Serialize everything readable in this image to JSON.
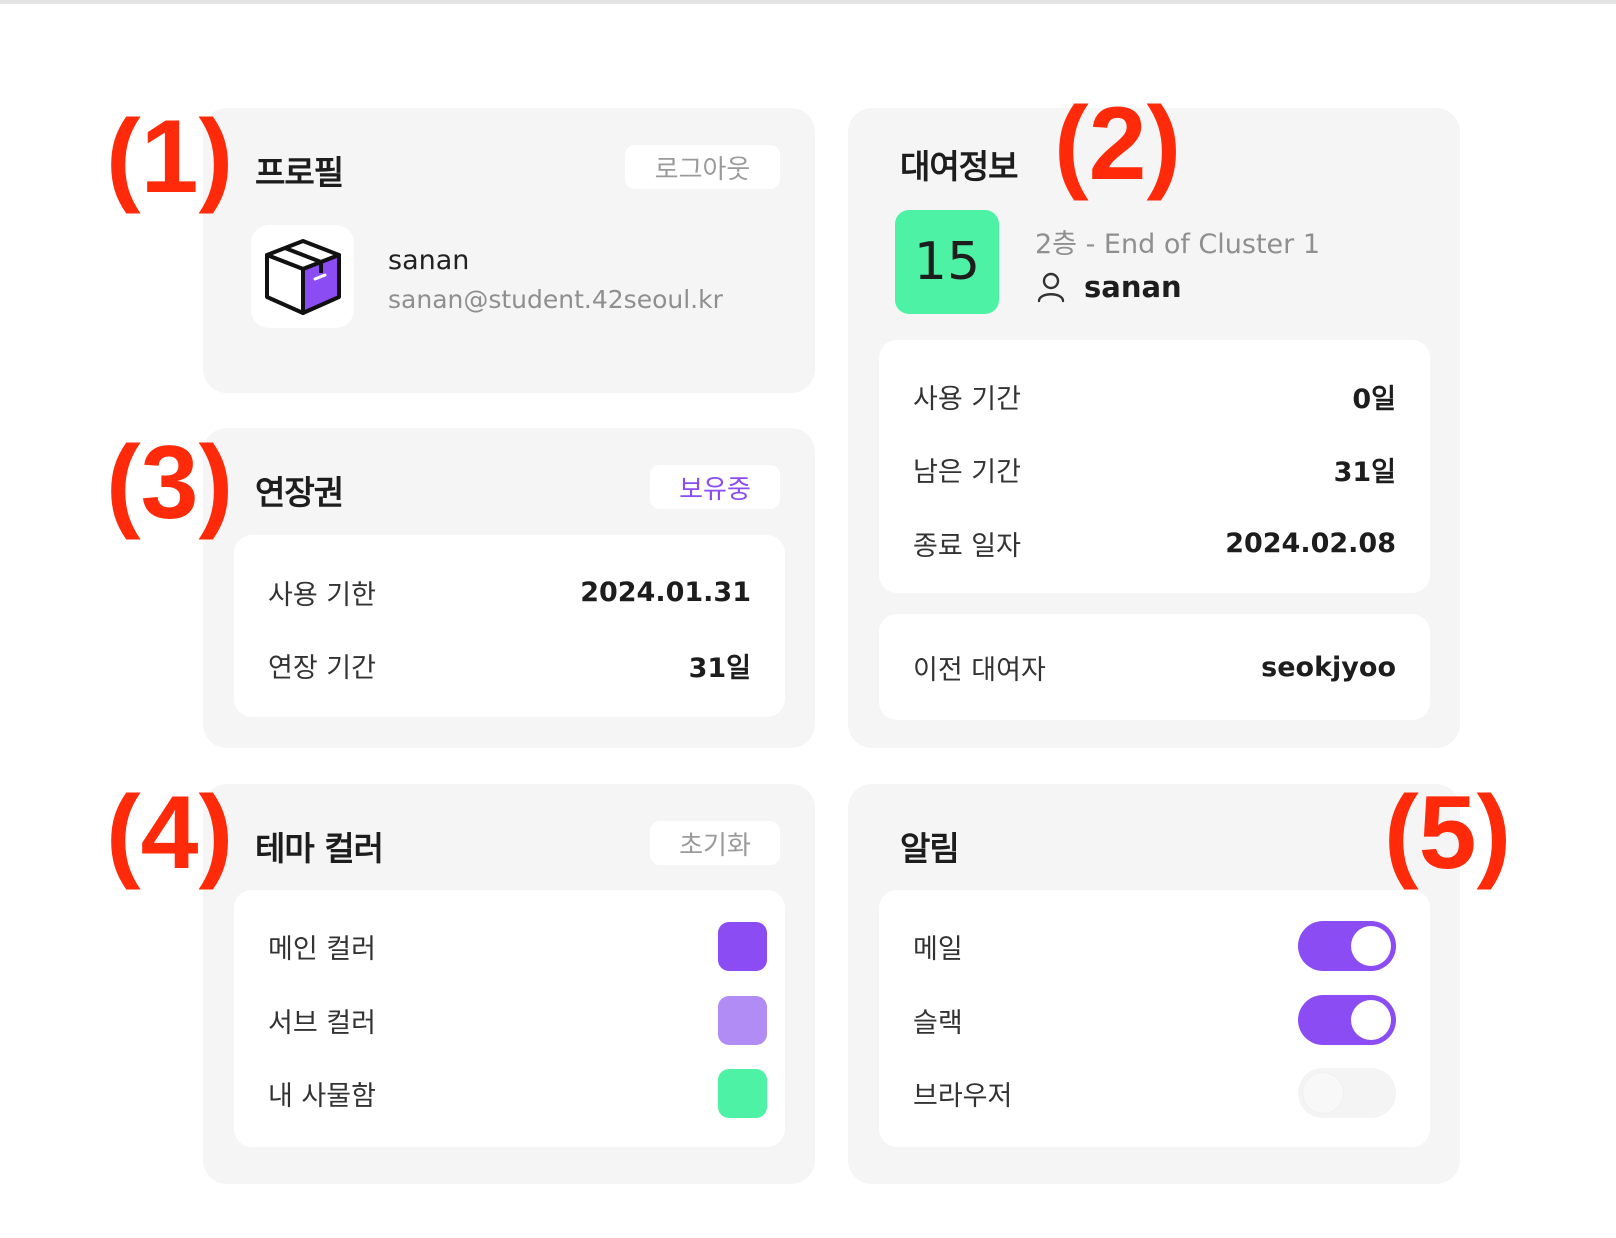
{
  "colors": {
    "main": "#8b4cf3",
    "sub": "#b18cf5",
    "my_cabinet": "#4df2a5",
    "annotation": "#ff2a0a"
  },
  "annotations": [
    "(1)",
    "(2)",
    "(3)",
    "(4)",
    "(5)"
  ],
  "profile": {
    "title": "프로필",
    "logout_label": "로그아웃",
    "avatar_icon": "box-icon",
    "username": "sanan",
    "email": "sanan@student.42seoul.kr"
  },
  "rental": {
    "title": "대여정보",
    "cabinet_number": "15",
    "location": "2층 - End of Cluster 1",
    "user_icon": "user-icon",
    "user": "sanan",
    "details": [
      {
        "label": "사용 기간",
        "value": "0일"
      },
      {
        "label": "남은 기간",
        "value": "31일"
      },
      {
        "label": "종료 일자",
        "value": "2024.02.08"
      }
    ],
    "previous": {
      "label": "이전 대여자",
      "value": "seokjyoo"
    }
  },
  "extension": {
    "title": "연장권",
    "status_label": "보유중",
    "rows": [
      {
        "label": "사용 기한",
        "value": "2024.01.31"
      },
      {
        "label": "연장 기간",
        "value": "31일"
      }
    ]
  },
  "theme": {
    "title": "테마 컬러",
    "reset_label": "초기화",
    "rows": [
      {
        "label": "메인 컬러",
        "color": "#8b4cf3"
      },
      {
        "label": "서브 컬러",
        "color": "#b18cf5"
      },
      {
        "label": "내 사물함",
        "color": "#4df2a5"
      }
    ]
  },
  "notifications": {
    "title": "알림",
    "rows": [
      {
        "label": "메일",
        "enabled": true
      },
      {
        "label": "슬랙",
        "enabled": true
      },
      {
        "label": "브라우저",
        "enabled": false
      }
    ]
  }
}
